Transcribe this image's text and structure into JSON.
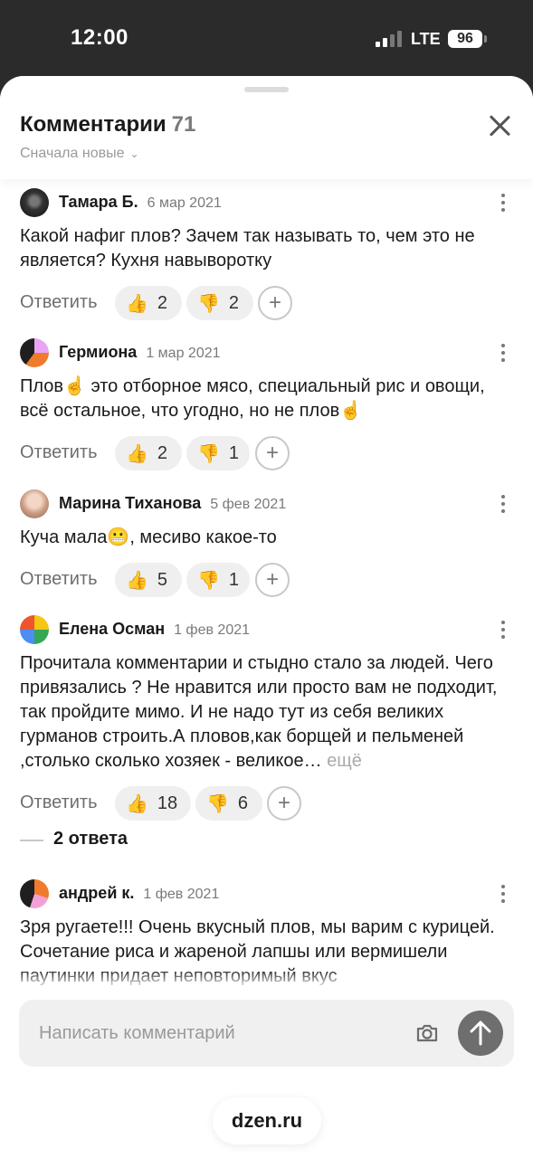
{
  "status": {
    "time": "12:00",
    "network": "LTE",
    "battery": "96"
  },
  "header": {
    "title": "Комментарии",
    "count": "71",
    "sort_label": "Сначала новые"
  },
  "comments": [
    {
      "author": "Тамара Б.",
      "date": "6 мар 2021",
      "text": "Какой нафиг плов? Зачем так называть то, чем это не является? Кухня навыворотку",
      "likes": "2",
      "dislikes": "2"
    },
    {
      "author": "Гермиона",
      "date": "1 мар 2021",
      "text": "Плов☝️ это отборное мясо, специальный рис и овощи, всё остальное, что угодно, но не плов☝️",
      "likes": "2",
      "dislikes": "1"
    },
    {
      "author": "Марина Тиханова",
      "date": "5 фев 2021",
      "text": "Куча мала😬, месиво какое-то",
      "likes": "5",
      "dislikes": "1"
    },
    {
      "author": "Елена Осман",
      "date": "1 фев 2021",
      "text": "Прочитала комментарии и стыдно стало за людей. Чего привязались ? Не нравится или просто вам не подходит, так пройдите мимо. И не надо тут из себя великих гурманов строить.А пловов,как борщей и пельменей ,столько сколько хозяек - великое…",
      "more": "ещё",
      "likes": "18",
      "dislikes": "6"
    },
    {
      "author": "андрей к.",
      "date": "1 фев 2021",
      "text": "Зря ругаете!!! Очень вкусный плов, мы варим с курицей. Сочетание риса и жареной лапшы или вермишели паутинки придает неповторимый вкус"
    }
  ],
  "reply_label": "Ответить",
  "replies_toggle": "2 ответа",
  "emoji": {
    "like": "👍",
    "dislike": "👎",
    "add": "+"
  },
  "composer": {
    "placeholder": "Написать комментарий"
  },
  "domain": "dzen.ru",
  "icons": {
    "close": "close-icon",
    "camera": "camera-icon",
    "send": "arrow-up-icon",
    "more": "kebab-icon"
  }
}
